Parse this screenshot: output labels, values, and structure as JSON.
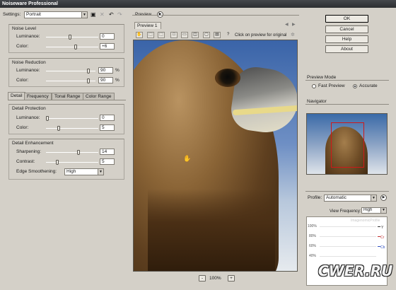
{
  "app": {
    "title": "Noiseware Professional"
  },
  "settings": {
    "label": "Settings:",
    "value": "Portrait"
  },
  "noise_level": {
    "title": "Noise Level",
    "luminance": {
      "label": "Luminance:",
      "value": "0"
    },
    "color": {
      "label": "Color:",
      "value": "+6"
    }
  },
  "noise_reduction": {
    "title": "Noise Reduction",
    "luminance": {
      "label": "Luminance:",
      "value": "90",
      "unit": "%"
    },
    "color": {
      "label": "Color:",
      "value": "90",
      "unit": "%"
    }
  },
  "tabs": [
    "Detail",
    "Frequency",
    "Tonal Range",
    "Color Range"
  ],
  "detail_protection": {
    "title": "Detail Protection",
    "luminance": {
      "label": "Luminance:",
      "value": "0"
    },
    "color": {
      "label": "Color:",
      "value": "5"
    }
  },
  "detail_enhancement": {
    "title": "Detail Enhancement",
    "sharpening": {
      "label": "Sharpening:",
      "value": "14"
    },
    "contrast": {
      "label": "Contrast:",
      "value": "5"
    },
    "edge_smoothening": {
      "label": "Edge Smoothening:",
      "value": "High"
    }
  },
  "preview": {
    "title": "Preview",
    "tab": "Preview 1",
    "hint": "Click on preview for original",
    "zoom": "100%",
    "zoom_minus": "-",
    "zoom_plus": "+"
  },
  "buttons": {
    "ok": "OK",
    "cancel": "Cancel",
    "help": "Help",
    "about": "About"
  },
  "preview_mode": {
    "title": "Preview Mode",
    "fast": "Fast Preview",
    "accurate": "Accurate",
    "selected": "accurate"
  },
  "navigator": {
    "title": "Navigator"
  },
  "profile": {
    "label": "Profile:",
    "value": "Automatic",
    "view_frequency_label": "View Frequency:",
    "view_frequency_value": "High",
    "y_ticks": [
      "100%",
      "80%",
      "60%",
      "40%"
    ],
    "channels": [
      "Y",
      "Cr",
      "Cb"
    ],
    "watermark": "ImagenomicProfile"
  },
  "watermark": "CWER.RU"
}
